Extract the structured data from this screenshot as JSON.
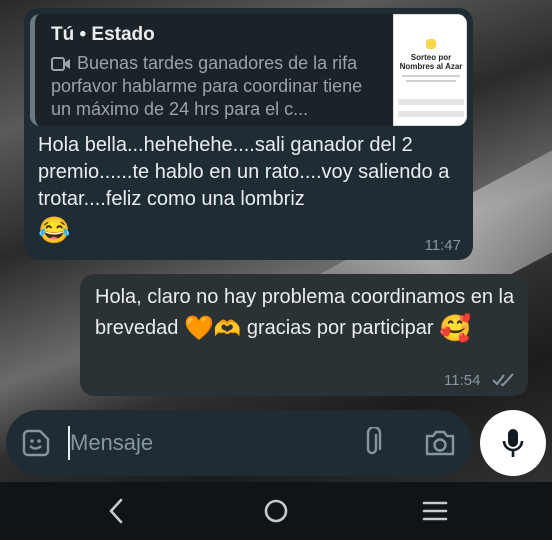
{
  "chat": {
    "incoming": {
      "quote_author": "Tú • Estado",
      "quote_text": "Buenas tardes ganadores de la rifa porfavor hablarme para coordinar tiene un máximo de 24 hrs para el c...",
      "thumbnail_title": "Sorteo por Nombres al Azar",
      "text": "Hola bella...hehehehe....sali ganador del 2 premio......te hablo en un rato....voy saliendo a trotar....feliz como una lombriz",
      "emoji": "😂",
      "time": "11:47"
    },
    "outgoing": {
      "text_part1": "Hola, claro no hay problema coordinamos en la brevedad",
      "emoji_heart": "🧡",
      "emoji_hands": "🫶",
      "text_part2": "gracias por participar",
      "emoji_face": "🥰",
      "time": "11:54",
      "status": "read"
    }
  },
  "composer": {
    "placeholder": "Mensaje"
  },
  "colors": {
    "incoming_bubble": "#202c33",
    "outgoing_bubble": "#2a3236",
    "timestamp": "#8696a0",
    "orange_heart": "#f5871f"
  },
  "icons": [
    "camera-icon",
    "sticker-icon",
    "paperclip-icon",
    "camera-icon",
    "microphone-icon",
    "back-icon",
    "home-icon",
    "recents-icon",
    "double-check-icon"
  ]
}
